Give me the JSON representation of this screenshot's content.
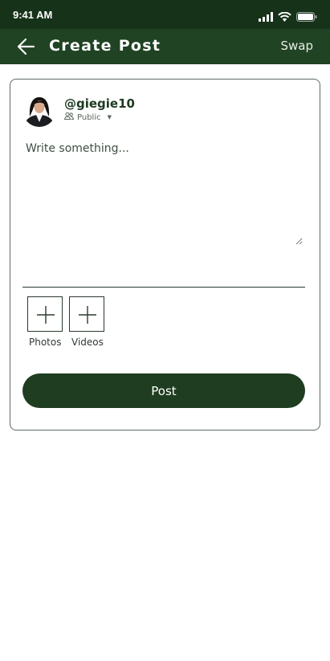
{
  "status_bar": {
    "time": "9:41 AM",
    "icons": [
      "signal-icon",
      "wifi-icon",
      "battery-icon"
    ]
  },
  "app_bar": {
    "back_icon": "arrow-left-icon",
    "title": "Create Post",
    "swap_label": "Swap"
  },
  "composer": {
    "username": "@giegie10",
    "privacy_icon": "people-icon",
    "privacy": "Public",
    "privacy_caret": "▼",
    "placeholder": "Write something...",
    "value": ""
  },
  "media": {
    "photos_label": "Photos",
    "videos_label": "Videos",
    "add_icon": "plus-icon"
  },
  "actions": {
    "post_label": "Post"
  },
  "colors": {
    "status_bar": "#163219",
    "app_bar": "#204323",
    "post_button": "#1f3d21",
    "text_dark": "#1d3a20"
  }
}
